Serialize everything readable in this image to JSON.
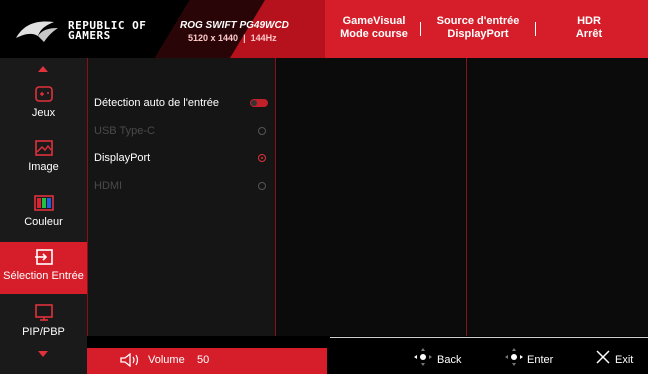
{
  "header": {
    "brand_line1": "REPUBLIC OF",
    "brand_line2": "GAMERS",
    "model": "ROG SWIFT PG49WCD",
    "resolution": "5120 x 1440",
    "refresh": "144Hz",
    "status": [
      {
        "label": "GameVisual",
        "value": "Mode course"
      },
      {
        "label": "Source d'entrée",
        "value": "DisplayPort"
      },
      {
        "label": "HDR",
        "value": "Arrêt"
      }
    ]
  },
  "sidebar": {
    "items": [
      {
        "label": "Jeux",
        "icon": "gamepad-icon"
      },
      {
        "label": "Image",
        "icon": "image-icon"
      },
      {
        "label": "Couleur",
        "icon": "color-icon"
      },
      {
        "label": "Sélection Entrée",
        "icon": "input-select-icon",
        "active": true
      },
      {
        "label": "PIP/PBP",
        "icon": "pip-icon"
      }
    ]
  },
  "input_menu": {
    "auto_detect": "Détection auto de l'entrée",
    "options": [
      {
        "label": "USB Type-C",
        "enabled": false,
        "selected": false
      },
      {
        "label": "DisplayPort",
        "enabled": true,
        "selected": true
      },
      {
        "label": "HDMI",
        "enabled": false,
        "selected": false
      }
    ]
  },
  "footer": {
    "volume_label": "Volume",
    "volume_value": "50",
    "back": "Back",
    "enter": "Enter",
    "exit": "Exit"
  },
  "colors": {
    "accent": "#d51e2a",
    "panel": "#151515"
  }
}
